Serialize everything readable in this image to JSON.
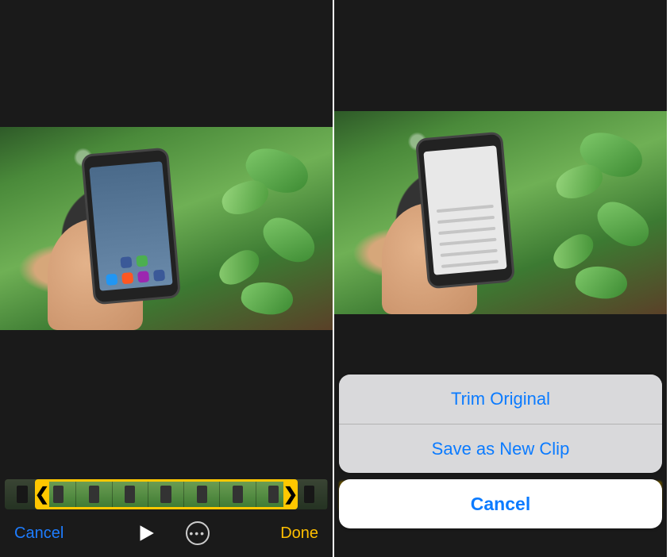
{
  "left": {
    "toolbar": {
      "cancel_label": "Cancel",
      "done_label": "Done",
      "play_label": "Play",
      "more_label": "More"
    },
    "trim": {
      "selection_start_frame": 1,
      "selection_end_frame": 8,
      "total_frames": 9,
      "handle_glyph_left": "❮",
      "handle_glyph_right": "❯"
    }
  },
  "right": {
    "action_sheet": {
      "options": [
        {
          "id": "trim-original",
          "label": "Trim Original"
        },
        {
          "id": "save-as-new-clip",
          "label": "Save as New Clip"
        }
      ],
      "cancel_label": "Cancel"
    }
  },
  "colors": {
    "ios_blue": "#0b7bff",
    "accent_yellow": "#ffc800",
    "done_yellow": "#ffbf00"
  }
}
